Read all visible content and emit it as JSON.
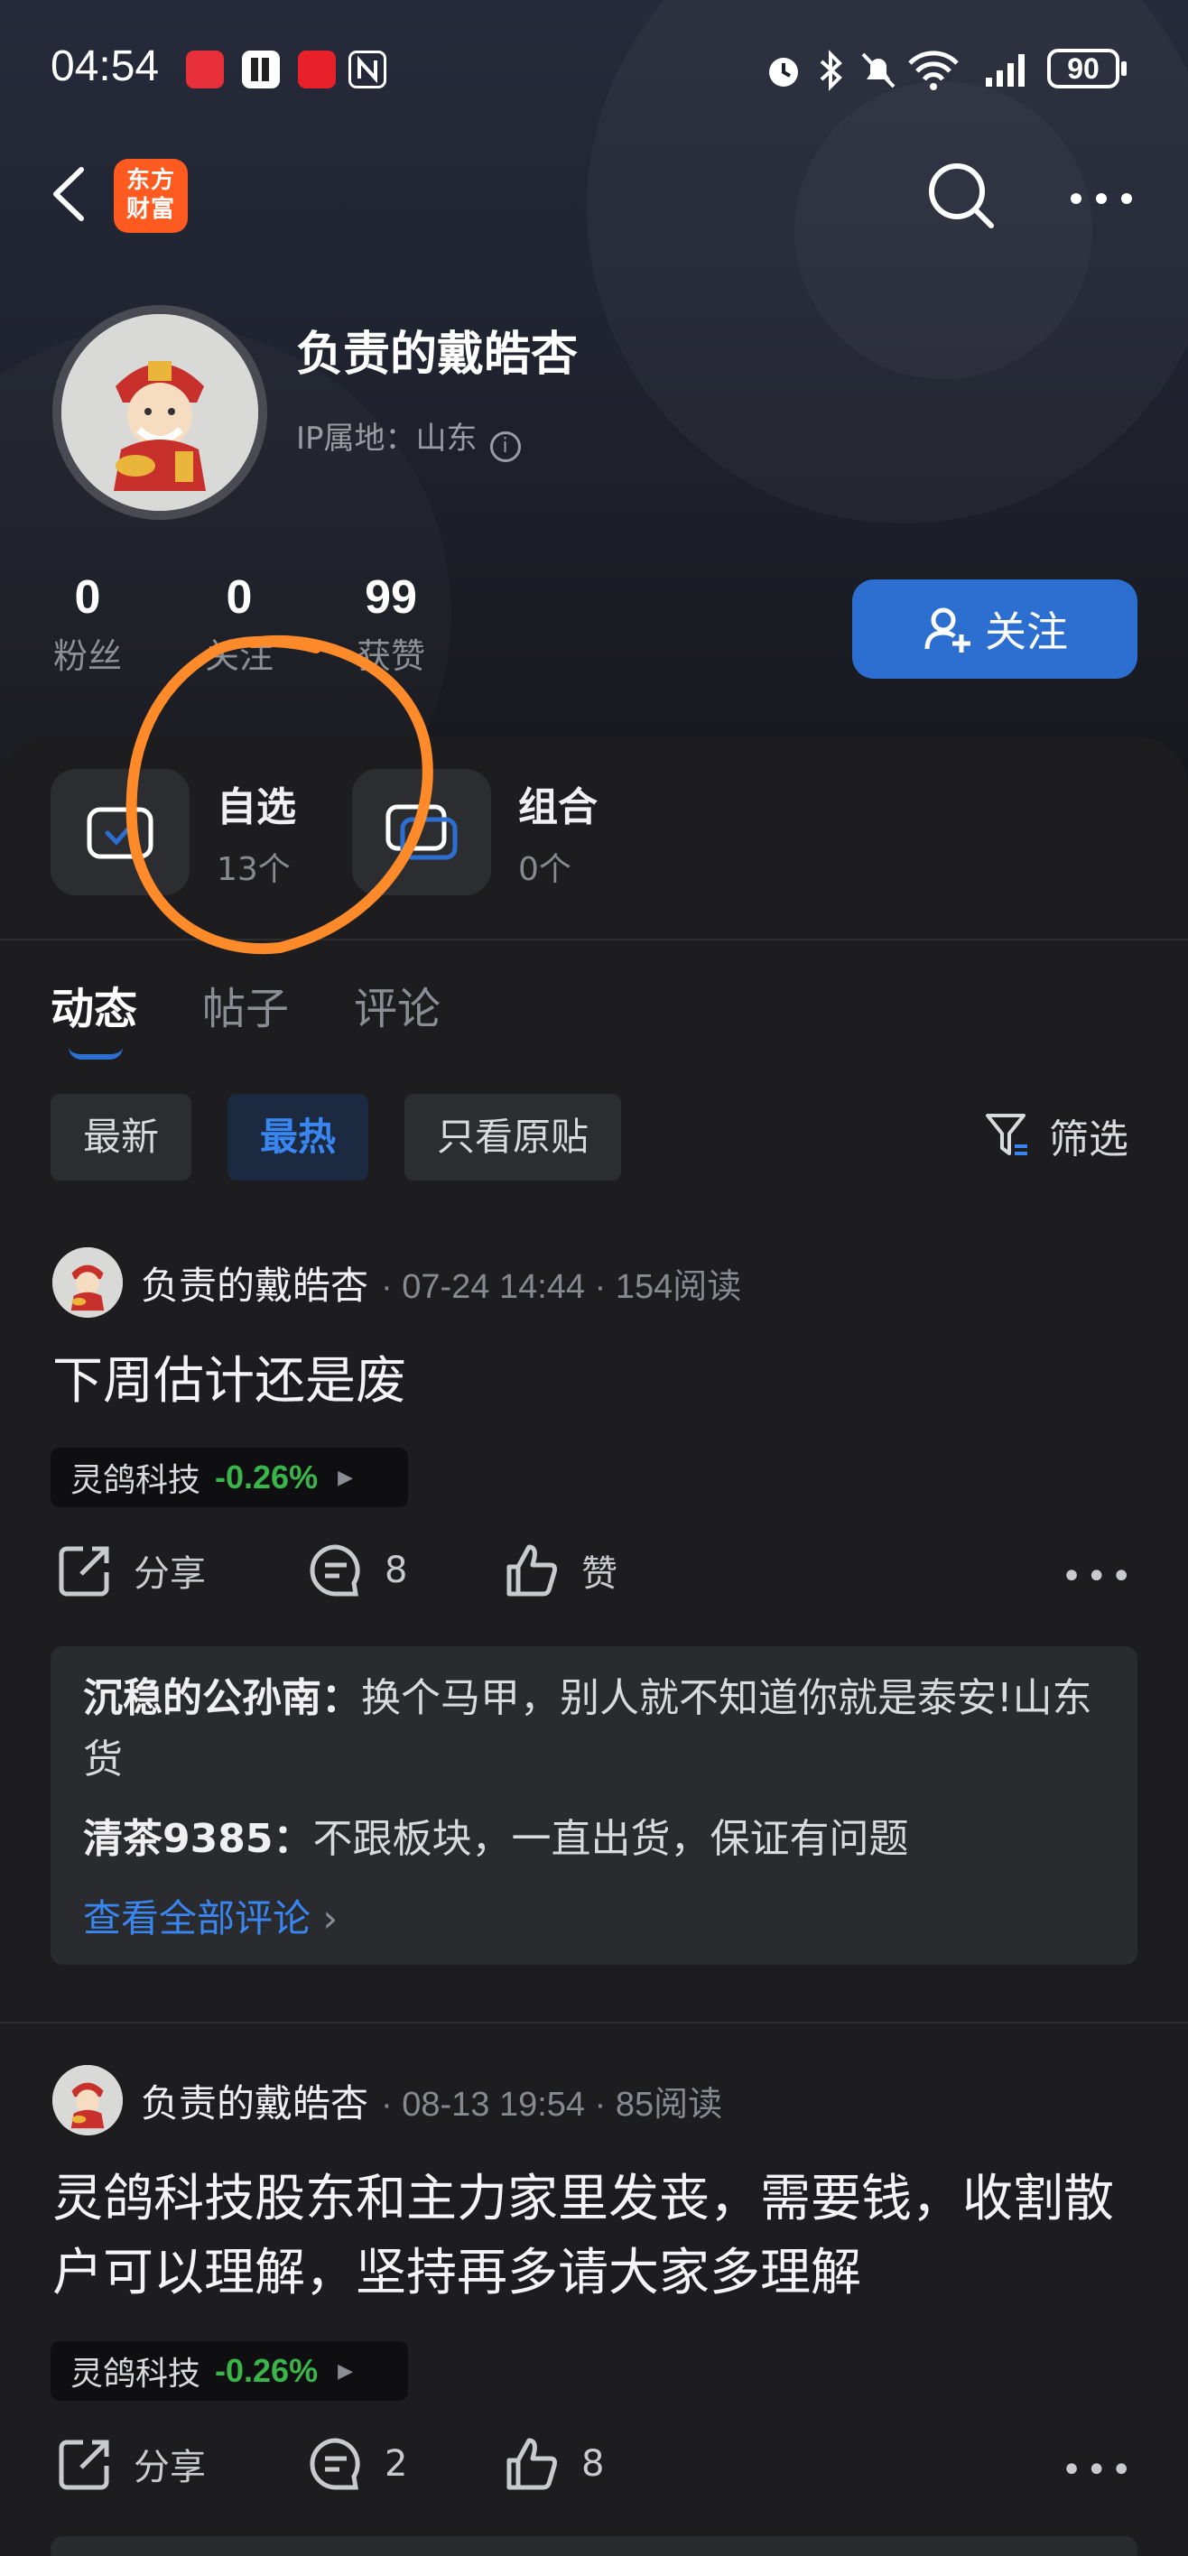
{
  "status_bar": {
    "time": "04:54",
    "battery": "90",
    "app_icons": [
      "huawei-app-icon",
      "shield-app-icon",
      "red-app-icon",
      "nfc-icon"
    ],
    "system_icons": [
      "alarm-icon",
      "bluetooth-icon",
      "mute-icon",
      "wifi-icon",
      "signal-icon"
    ]
  },
  "nav": {
    "logo_text_line1": "东方",
    "logo_text_line2": "财富"
  },
  "profile": {
    "name": "负责的戴皓杏",
    "ip_location": "IP属地：山东",
    "info_glyph": "i",
    "stats": [
      {
        "value": "0",
        "label": "粉丝"
      },
      {
        "value": "0",
        "label": "关注"
      },
      {
        "value": "99",
        "label": "获赞"
      }
    ],
    "follow_label": "关注"
  },
  "quick_cards": [
    {
      "title": "自选",
      "subtitle": "13个"
    },
    {
      "title": "组合",
      "subtitle": "0个"
    }
  ],
  "tabs": [
    "动态",
    "帖子",
    "评论"
  ],
  "filters": {
    "chips": [
      "最新",
      "最热",
      "只看原贴"
    ],
    "active_chip": "最热",
    "filter_label": "筛选"
  },
  "posts": [
    {
      "author": "负责的戴皓杏",
      "meta": "· 07-24 14:44 · 154阅读",
      "body": "下周估计还是废",
      "stock_name": "灵鸽科技",
      "stock_change": "-0.26%",
      "share_label": "分享",
      "comment_count": "8",
      "like_label": "赞",
      "comments": [
        {
          "user": "沉稳的公孙南：",
          "text": "换个马甲，别人就不知道你就是泰安!山东货"
        },
        {
          "user": "清茶9385：",
          "text": "不跟板块，一直出货，保证有问题"
        }
      ],
      "see_all_label": "查看全部评论",
      "see_all_chevron": "›"
    },
    {
      "author": "负责的戴皓杏",
      "meta": "· 08-13 19:54 · 85阅读",
      "body": "灵鸽科技股东和主力家里发丧，需要钱，收割散户可以理解，坚持再多请大家多理解",
      "stock_name": "灵鸽科技",
      "stock_change": "-0.26%",
      "share_label": "分享",
      "comment_count": "2",
      "like_label": "8"
    }
  ],
  "colors": {
    "accent": "#2c6fd1",
    "link": "#3a86f0",
    "stock_down": "#39b54a",
    "logo": "#ff5a1f",
    "annotation": "#ff8a2a"
  }
}
